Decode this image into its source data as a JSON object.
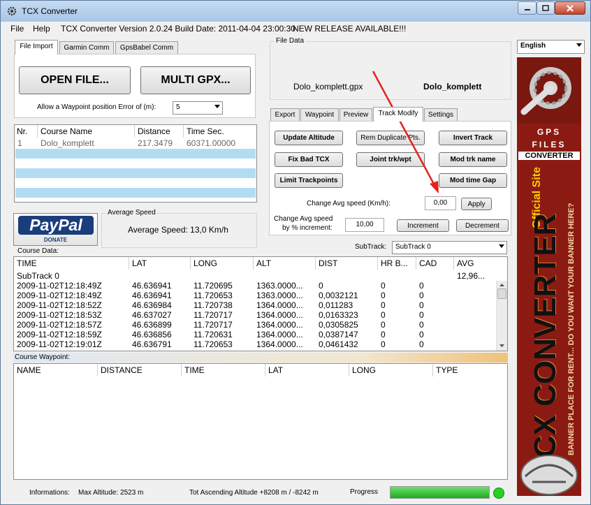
{
  "window": {
    "title": "TCX Converter"
  },
  "menubar": {
    "file": "File",
    "help": "Help",
    "version": "TCX Converter Version 2.0.24 Build Date: 2011-04-04 23:00:30",
    "release": "NEW RELEASE AVAILABLE!!!"
  },
  "left_tabs": [
    "File Import",
    "Garmin Comm",
    "GpsBabel Comm"
  ],
  "file_import": {
    "open_label": "OPEN FILE...",
    "multi_label": "MULTI GPX...",
    "waypoint_error_label": "Allow a Waypoint position Error of (m):",
    "waypoint_error_value": "5"
  },
  "course_list": {
    "headers": [
      "Nr.",
      "Course Name",
      "Distance",
      "Time Sec."
    ],
    "rows": [
      [
        "1",
        "Dolo_komplett",
        "217.3479",
        "60371.00000"
      ]
    ]
  },
  "paypal": {
    "brand": "PayPal",
    "donate": "DONATE"
  },
  "avg_speed": {
    "title": "Average Speed",
    "text": "Average Speed: 13,0 Km/h"
  },
  "file_data": {
    "title": "File Data",
    "filename": "Dolo_komplett.gpx",
    "course": "Dolo_komplett"
  },
  "right_tabs": [
    "Export",
    "Waypoint",
    "Preview",
    "Track Modify",
    "Settings"
  ],
  "track_modify": {
    "update_altitude": "Update Altitude",
    "rem_duplicate": "Rem Duplicate Pts.",
    "invert_track": "Invert Track",
    "fix_bad": "Fix Bad TCX",
    "joint": "Joint trk/wpt",
    "mod_trk_name": "Mod trk name",
    "limit": "Limit Trackpoints",
    "mod_time_gap": "Mod time Gap",
    "change_avg_label": "Change Avg speed (Km/h):",
    "change_avg_value": "0,00",
    "apply": "Apply",
    "change_pct_label1": "Change Avg speed",
    "change_pct_label2": "by % increment:",
    "change_pct_value": "10,00",
    "increment": "Increment",
    "decrement": "Decrement"
  },
  "subtrack": {
    "label": "SubTrack:",
    "value": "SubTrack 0"
  },
  "course_data": {
    "title": "Course Data:",
    "headers": [
      "TIME",
      "LAT",
      "LONG",
      "ALT",
      "DIST",
      "HR B...",
      "CAD",
      "AVG"
    ],
    "group_label": "SubTrack 0",
    "group_avg": "12,96...",
    "rows": [
      [
        "2009-11-02T12:18:49Z",
        "46.636941",
        "11.720695",
        "1363.0000...",
        "0",
        "0",
        "0"
      ],
      [
        "2009-11-02T12:18:49Z",
        "46.636941",
        "11.720653",
        "1363.0000...",
        "0,0032121",
        "0",
        "0"
      ],
      [
        "2009-11-02T12:18:52Z",
        "46.636984",
        "11.720738",
        "1364.0000...",
        "0,011283",
        "0",
        "0"
      ],
      [
        "2009-11-02T12:18:53Z",
        "46.637027",
        "11.720717",
        "1364.0000...",
        "0,0163323",
        "0",
        "0"
      ],
      [
        "2009-11-02T12:18:57Z",
        "46.636899",
        "11.720717",
        "1364.0000...",
        "0,0305825",
        "0",
        "0"
      ],
      [
        "2009-11-02T12:18:59Z",
        "46.636856",
        "11.720631",
        "1364.0000...",
        "0,0387147",
        "0",
        "0"
      ],
      [
        "2009-11-02T12:19:01Z",
        "46.636791",
        "11.720653",
        "1364.0000...",
        "0,0461432",
        "0",
        "0"
      ]
    ]
  },
  "course_waypoint": {
    "title": "Course Waypoint:",
    "headers": [
      "NAME",
      "DISTANCE",
      "TIME",
      "LAT",
      "LONG",
      "TYPE"
    ]
  },
  "language": {
    "value": "English"
  },
  "banner": {
    "gps": "GPS",
    "files": "FILES",
    "converter": "CONVERTER",
    "official": "Official Site",
    "main": "TCX CONVERTER",
    "rent": "BANNER PLACE FOR RENT... DO YOU WANT YOUR BANNER HERE?"
  },
  "status": {
    "info": "Informations:",
    "max_alt": "Max Altitude: 2523 m",
    "ascending": "Tot Ascending Altitude +8208 m / -8242 m",
    "progress_label": "Progress",
    "progress": 1.0
  },
  "colors": {
    "accent_red": "#e8201a",
    "stripe": "#b3dcf2",
    "banner": "#8b1b12",
    "progress": "#23c023"
  }
}
